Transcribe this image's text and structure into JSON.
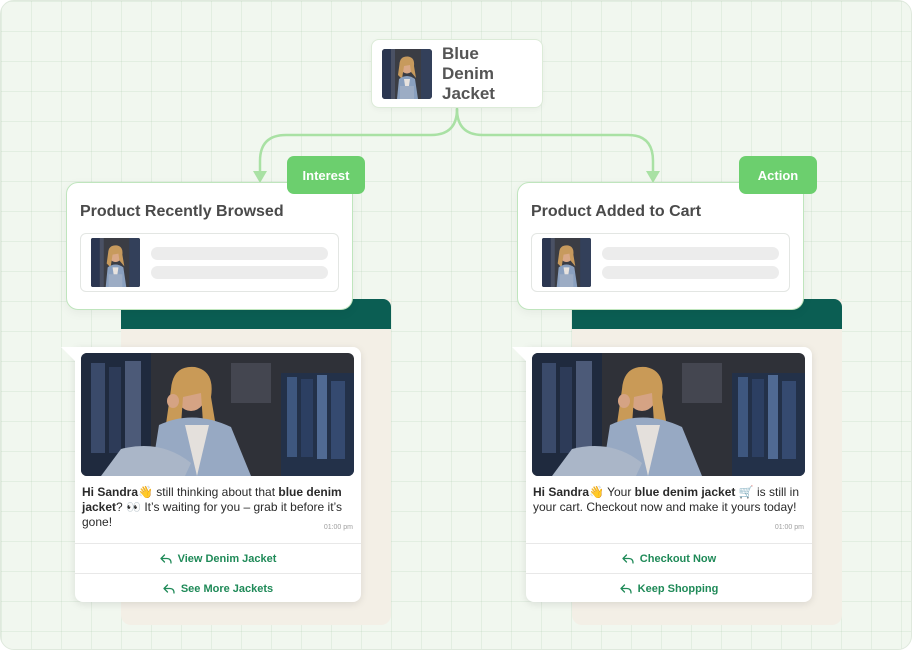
{
  "product": {
    "name": "Blue Denim\nJacket",
    "icon": "product-thumbnail"
  },
  "colors": {
    "accent_green": "#6ccf6e",
    "connector_green": "#a9e1a4",
    "header_teal": "#0b5e53",
    "button_text": "#1f8a58",
    "canvas_bg": "#f1f7ef"
  },
  "flows": [
    {
      "tag": "Interest",
      "card_title": "Product Recently Browsed",
      "message": {
        "greeting": "Hi Sandra",
        "emoji1": "👋",
        "text1": " still thinking about that ",
        "bold": "blue denim jacket",
        "text2": "? ",
        "emoji2": "👀",
        "text3": " It’s waiting for you – grab it before it’s gone!"
      },
      "time": "01:00 pm",
      "buttons": [
        "View Denim Jacket",
        "See More Jackets"
      ]
    },
    {
      "tag": "Action",
      "card_title": "Product Added to Cart",
      "message": {
        "greeting": "Hi Sandra",
        "emoji1": "👋",
        "text1": " Your ",
        "bold": "blue denim jacket",
        "text2": " ",
        "emoji2": "🛒",
        "text3": " is still in your cart. Checkout now and make it yours today!"
      },
      "time": "01:00 pm",
      "buttons": [
        "Checkout Now",
        "Keep Shopping"
      ]
    }
  ]
}
